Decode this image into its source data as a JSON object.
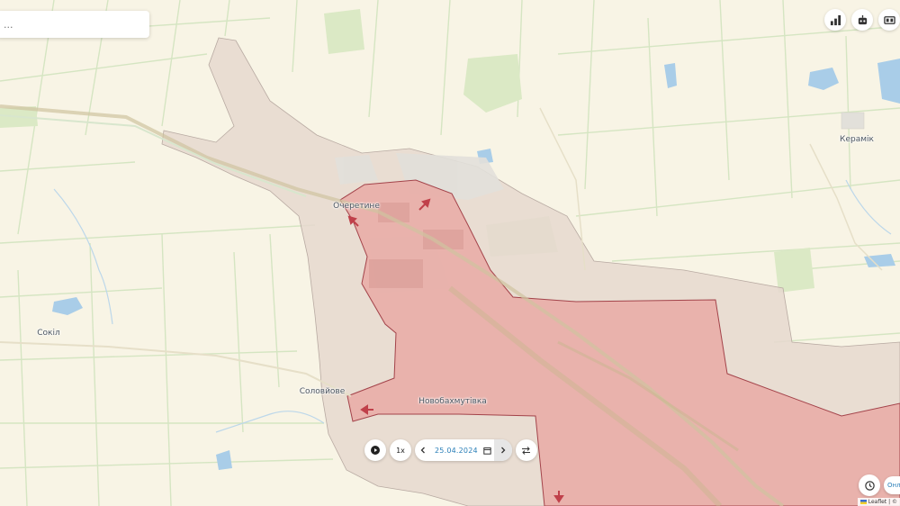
{
  "search": {
    "placeholder": "...",
    "value": ""
  },
  "toolbar": {
    "buttons": [
      {
        "name": "stats-button",
        "icon": "bar-chart-icon"
      },
      {
        "name": "bot-button",
        "icon": "robot-icon"
      },
      {
        "name": "display-button",
        "icon": "screen-icon"
      }
    ]
  },
  "places": [
    {
      "key": "ocheretyne",
      "label": "Очеретине"
    },
    {
      "key": "keramik",
      "label": "Керамік"
    },
    {
      "key": "sokil",
      "label": "Сокіл"
    },
    {
      "key": "solovyove",
      "label": "Соловйове"
    },
    {
      "key": "novobakhmutivka",
      "label": "Новобахмутівка"
    }
  ],
  "timeline": {
    "play_icon": "play-icon",
    "speed_label": "1x",
    "prev_icon": "chevron-left-icon",
    "date": "25.04.2024",
    "calendar_icon": "calendar-icon",
    "next_icon": "chevron-right-icon",
    "swap_icon": "swap-arrows-icon"
  },
  "bottom_right": {
    "history_icon": "history-icon",
    "lang_label": "Онл"
  },
  "attribution": {
    "text": "Leaflet | ©"
  },
  "colors": {
    "background": "#f8f4e5",
    "fields": "#f2edd9",
    "field_lines": "#d9e6c8",
    "green_patch": "#dbe9c5",
    "water": "#a9cde8",
    "contested_zone": "#e5d7cf",
    "occupied_zone": "#e8b1ab",
    "occupied_border": "#a3434a",
    "arrow": "#c0404a",
    "date_text": "#2a7fb8"
  }
}
